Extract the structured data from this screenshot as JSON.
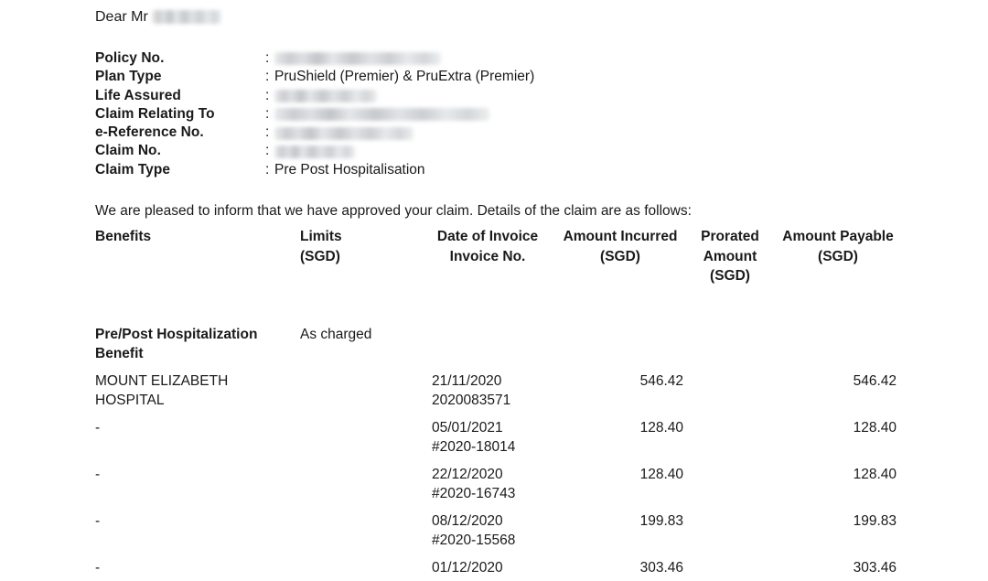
{
  "letter": {
    "salutation": "Dear Mr",
    "salutation_redacted": true,
    "intro": "We are pleased to inform that we have approved your claim. Details of the claim are as follows:"
  },
  "details": [
    {
      "label": "Policy No.",
      "separator": ":",
      "value": "",
      "redacted": true,
      "redact_width": 182
    },
    {
      "label": "Plan Type",
      "separator": ":",
      "value": "PruShield (Premier) & PruExtra (Premier)",
      "redacted": false,
      "redact_width": 0
    },
    {
      "label": "Life Assured",
      "separator": ":",
      "value": "",
      "redacted": true,
      "redact_width": 112
    },
    {
      "label": "Claim Relating To",
      "separator": ":",
      "value": "",
      "redacted": true,
      "redact_width": 235
    },
    {
      "label": "e-Reference No.",
      "separator": ":",
      "value": "",
      "redacted": true,
      "redact_width": 152
    },
    {
      "label": "Claim No.",
      "separator": ":",
      "value": "",
      "redacted": true,
      "redact_width": 88
    },
    {
      "label": "Claim Type",
      "separator": ":",
      "value": "Pre Post Hospitalisation",
      "redacted": false,
      "redact_width": 0
    }
  ],
  "table": {
    "headers": {
      "benefits": "Benefits",
      "limits_line1": "Limits",
      "limits_line2": "(SGD)",
      "invoice_line1": "Date of Invoice",
      "invoice_line2": "Invoice No.",
      "incurred_line1": "Amount Incurred",
      "incurred_line2": "(SGD)",
      "prorated_line1": "Prorated",
      "prorated_line2": "Amount",
      "prorated_line3": "(SGD)",
      "payable_line1": "Amount Payable",
      "payable_line2": "(SGD)"
    },
    "benefit_group": {
      "name_line1": "Pre/Post Hospitalization",
      "name_line2": "Benefit",
      "limit": "As charged"
    },
    "rows": [
      {
        "benefit_line1": "MOUNT ELIZABETH",
        "benefit_line2": "HOSPITAL",
        "limit": "",
        "invoice_date": "21/11/2020",
        "invoice_no": "2020083571",
        "amount_incurred": "546.42",
        "prorated_amount": "",
        "amount_payable": "546.42"
      },
      {
        "benefit_line1": "-",
        "benefit_line2": "",
        "limit": "",
        "invoice_date": "05/01/2021",
        "invoice_no": "#2020-18014",
        "amount_incurred": "128.40",
        "prorated_amount": "",
        "amount_payable": "128.40"
      },
      {
        "benefit_line1": "-",
        "benefit_line2": "",
        "limit": "",
        "invoice_date": "22/12/2020",
        "invoice_no": "#2020-16743",
        "amount_incurred": "128.40",
        "prorated_amount": "",
        "amount_payable": "128.40"
      },
      {
        "benefit_line1": "-",
        "benefit_line2": "",
        "limit": "",
        "invoice_date": "08/12/2020",
        "invoice_no": "#2020-15568",
        "amount_incurred": "199.83",
        "prorated_amount": "",
        "amount_payable": "199.83"
      },
      {
        "benefit_line1": "-",
        "benefit_line2": "",
        "limit": "",
        "invoice_date": "01/12/2020",
        "invoice_no": "",
        "amount_incurred": "303.46",
        "prorated_amount": "",
        "amount_payable": "303.46"
      }
    ]
  },
  "colors": {
    "background": "#ffffff",
    "text": "#1a1a1a",
    "redaction": "#d5d7da"
  }
}
